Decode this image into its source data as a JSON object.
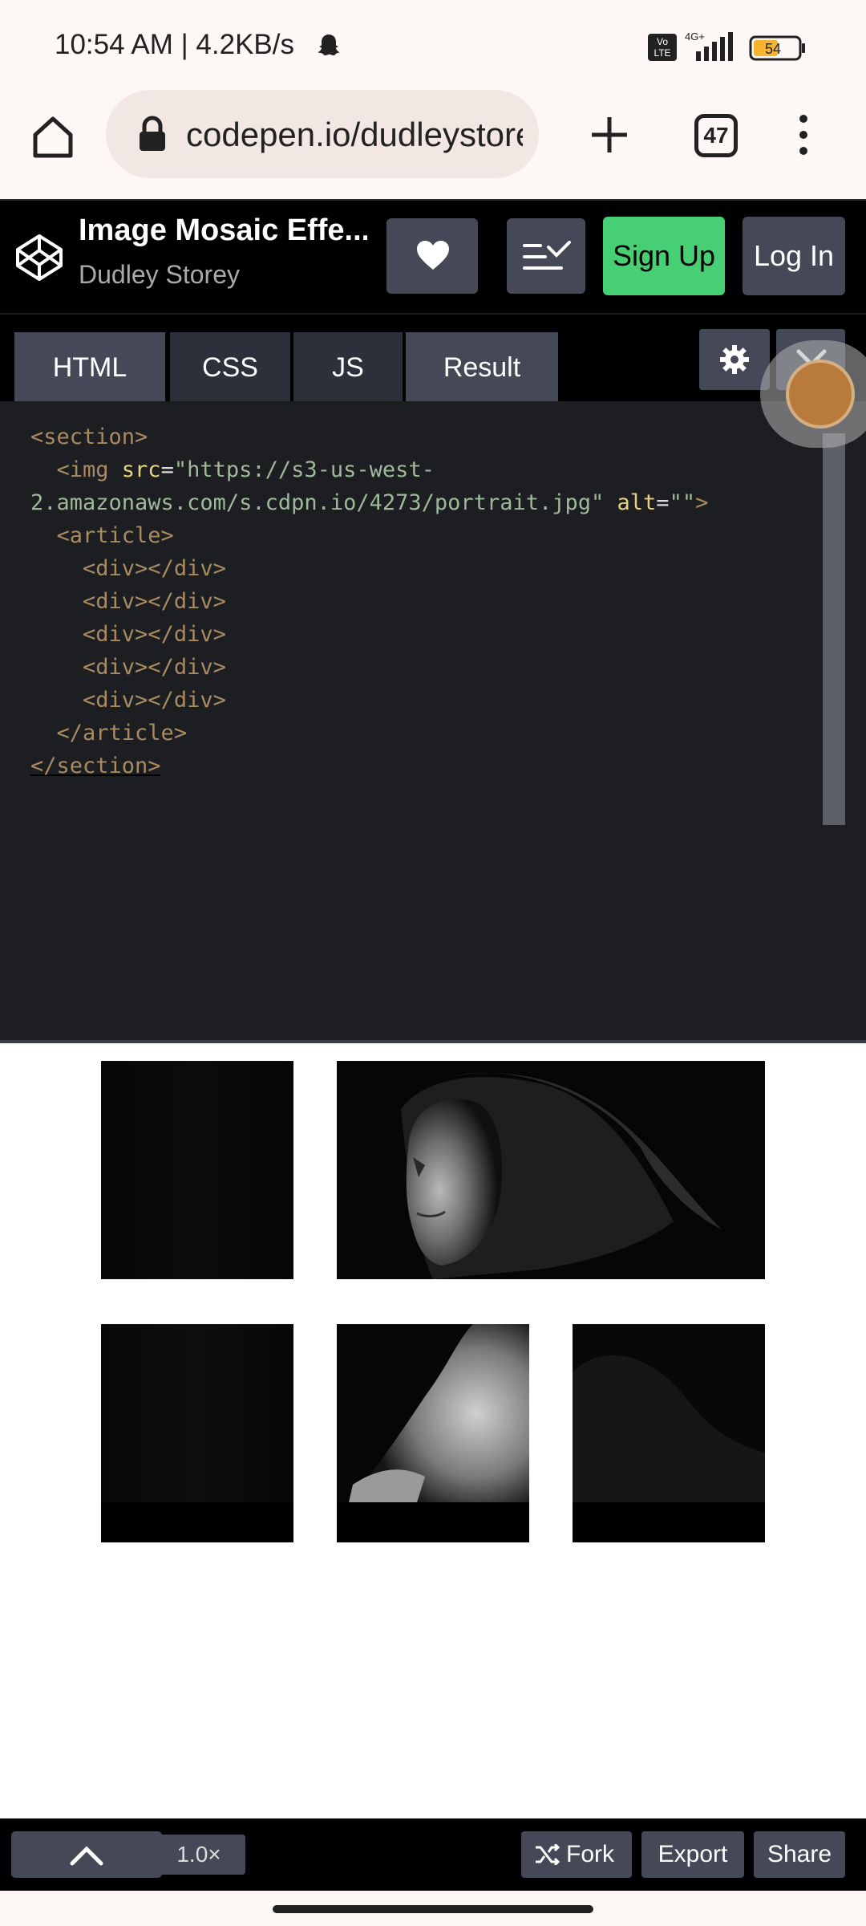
{
  "status_bar": {
    "time": "10:54 AM | 4.2KB/s",
    "network_badge": "Vo LTE",
    "network_type": "4G+",
    "battery": "54",
    "icons": [
      "snapchat-ghost-icon",
      "volte-icon",
      "signal-icon",
      "battery-icon"
    ]
  },
  "browser": {
    "url": "codepen.io/dudleystorey/pen",
    "tab_count": "47",
    "icons": [
      "home-icon",
      "lock-icon",
      "plus-icon",
      "menu-icon"
    ]
  },
  "codepen_header": {
    "title": "Image Mosaic Effe...",
    "author": "Dudley Storey",
    "signup_label": "Sign Up",
    "login_label": "Log In",
    "icons": [
      "codepen-logo-icon",
      "heart-icon",
      "views-icon"
    ]
  },
  "tabs": [
    {
      "label": "HTML",
      "active": true
    },
    {
      "label": "CSS",
      "active": false
    },
    {
      "label": "JS",
      "active": false
    },
    {
      "label": "Result",
      "active": true
    }
  ],
  "editor": {
    "lines": [
      {
        "tok": [
          [
            "tag",
            "<section>"
          ]
        ]
      },
      {
        "tok": [
          [
            "plain",
            "  "
          ],
          [
            "tag",
            "<img "
          ],
          [
            "attr",
            "src"
          ],
          [
            "plain",
            "="
          ],
          [
            "str",
            "\"https://s3-us-west-"
          ]
        ]
      },
      {
        "tok": [
          [
            "str",
            "2.amazonaws.com/s.cdpn.io/4273/portrait.jpg\""
          ],
          [
            "plain",
            " "
          ],
          [
            "attr",
            "alt"
          ],
          [
            "plain",
            "="
          ],
          [
            "str",
            "\"\""
          ],
          [
            "tag",
            ">"
          ]
        ]
      },
      {
        "tok": [
          [
            "plain",
            "  "
          ],
          [
            "tag",
            "<article>"
          ]
        ]
      },
      {
        "tok": [
          [
            "plain",
            "    "
          ],
          [
            "tag",
            "<div></div>"
          ]
        ]
      },
      {
        "tok": [
          [
            "plain",
            "    "
          ],
          [
            "tag",
            "<div></div>"
          ]
        ]
      },
      {
        "tok": [
          [
            "plain",
            "    "
          ],
          [
            "tag",
            "<div></div>"
          ]
        ]
      },
      {
        "tok": [
          [
            "plain",
            "    "
          ],
          [
            "tag",
            "<div></div>"
          ]
        ]
      },
      {
        "tok": [
          [
            "plain",
            "    "
          ],
          [
            "tag",
            "<div></div>"
          ]
        ]
      },
      {
        "tok": [
          [
            "plain",
            "  "
          ],
          [
            "tag",
            "</article>"
          ]
        ]
      },
      {
        "tok": [
          [
            "tag",
            "</section>"
          ]
        ]
      }
    ]
  },
  "result": {
    "tiles": [
      "tile-1",
      "tile-2",
      "tile-3",
      "tile-4",
      "tile-5"
    ]
  },
  "toolbar": {
    "zoom": "1.0×",
    "fork_label": "Fork",
    "export_label": "Export",
    "share_label": "Share"
  },
  "colors": {
    "accent_green": "#47cf73",
    "button_gray": "#444857",
    "editor_bg": "#1d1e22"
  }
}
